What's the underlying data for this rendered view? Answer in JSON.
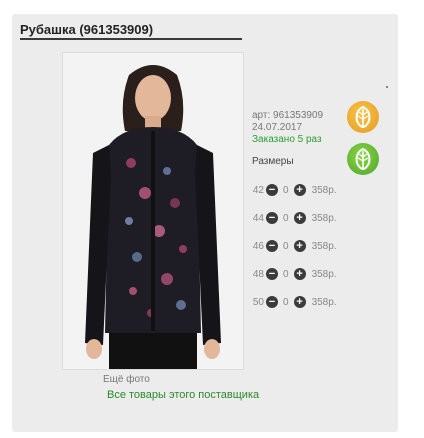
{
  "product": {
    "title": "Рубашка (961353909)",
    "article": "арт: 961353909",
    "date": "24.07.2017",
    "ordered": "Заказано 5 раз"
  },
  "photo": {
    "more_label": "Ещё фото"
  },
  "sizes": {
    "heading": "Размеры",
    "rows": [
      {
        "size": "42",
        "qty": "0",
        "price": "358р."
      },
      {
        "size": "44",
        "qty": "0",
        "price": "358р."
      },
      {
        "size": "46",
        "qty": "0",
        "price": "358р."
      },
      {
        "size": "48",
        "qty": "0",
        "price": "358р."
      },
      {
        "size": "50",
        "qty": "0",
        "price": "358р."
      }
    ]
  },
  "supplier_link": "Все товары этого поставщика",
  "colors": {
    "orange_badge": "#f0b12f",
    "green_badge": "#6cc23a",
    "link": "#2a8a2a"
  },
  "icons": [
    "leaf-icon",
    "leaf-icon",
    "minus-icon",
    "plus-icon"
  ]
}
